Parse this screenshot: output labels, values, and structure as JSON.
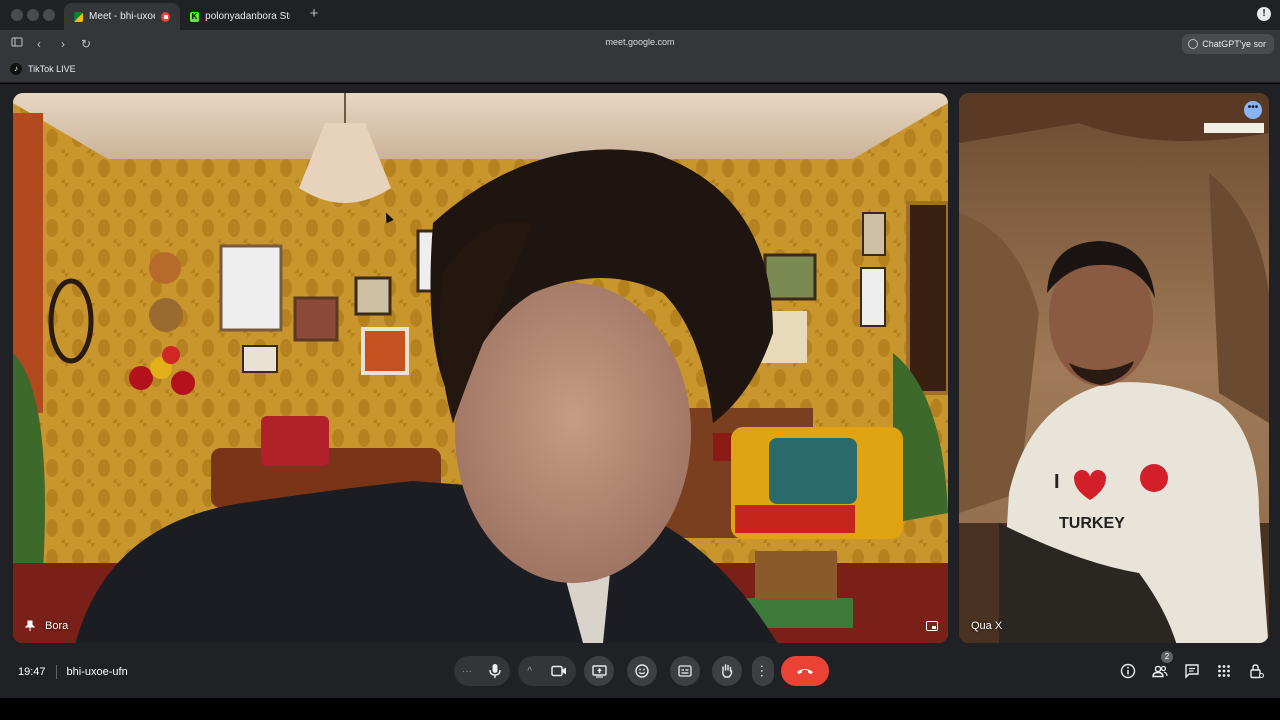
{
  "browser": {
    "tabs": [
      {
        "label": "Meet - bhi-uxoe-",
        "active": true
      },
      {
        "label": "polonyadanbora Stre",
        "active": false
      }
    ],
    "url": "meet.google.com",
    "assistant_button": "ChatGPT'ye sor",
    "bookmark": "TikTok LIVE"
  },
  "meet": {
    "participants": [
      {
        "name": "Bora",
        "pinned": true
      },
      {
        "name": "Qua X",
        "pinned": false
      }
    ],
    "time": "19:47",
    "meeting_code": "bhi-uxoe-ufn",
    "people_count": "2",
    "controls": [
      "more-options",
      "microphone",
      "camera-options",
      "camera",
      "present-screen",
      "reactions",
      "captions",
      "raise-hand",
      "more",
      "leave-call"
    ],
    "right_controls": [
      "meeting-details",
      "people",
      "chat",
      "activities",
      "host-controls"
    ]
  },
  "colors": {
    "end_call": "#ea4335",
    "accent": "#8ab4f8",
    "bar_bg": "#202124"
  }
}
